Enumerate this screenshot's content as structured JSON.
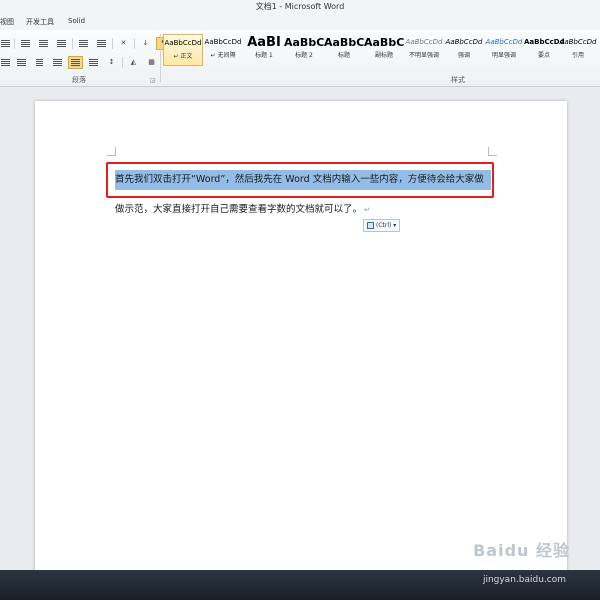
{
  "window": {
    "title": "文档1 - Microsoft Word"
  },
  "tabs": [
    "视图",
    "开发工具",
    "Solid"
  ],
  "ribbon": {
    "paragraph_group_label": "段落",
    "styles_group_label": "样式",
    "launcher_icon": "dialog-launcher-icon",
    "styles": [
      {
        "sample": "AaBbCcDd",
        "name": "↵ 正文",
        "selected": true
      },
      {
        "sample": "AaBbCcDd",
        "name": "↵ 无间隔",
        "selected": false
      },
      {
        "sample": "AaBI",
        "name": "标题 1",
        "selected": false
      },
      {
        "sample": "AaBbC",
        "name": "标题 2",
        "selected": false
      },
      {
        "sample": "AaBbC",
        "name": "标题",
        "selected": false
      },
      {
        "sample": "AaBbC",
        "name": "副标题",
        "selected": false
      },
      {
        "sample": "AaBbCcDd",
        "name": "不明显强调",
        "selected": false
      },
      {
        "sample": "AaBbCcDd",
        "name": "强调",
        "selected": false
      },
      {
        "sample": "AaBbCcDd",
        "name": "明显强调",
        "selected": false
      },
      {
        "sample": "AaBbCcDd",
        "name": "要点",
        "selected": false
      },
      {
        "sample": "AaBbCcDd",
        "name": "引用",
        "selected": false
      }
    ]
  },
  "document": {
    "line1": "首先我们双击打开“Word”，然后我先在 Word 文档内输入一些内容，方便待会给大家做",
    "line2": "做示范，大家直接打开自己需要查看字数的文档就可以了。",
    "paragraph_mark": "↵",
    "paste_options_label": "(Ctrl) ▾"
  },
  "watermark": {
    "logo": "Baidu 经验",
    "url": "jingyan.baidu.com"
  },
  "colors": {
    "selection": "#93bde6",
    "highlight_box": "#e02020",
    "selected_style": "#fde9a8"
  }
}
